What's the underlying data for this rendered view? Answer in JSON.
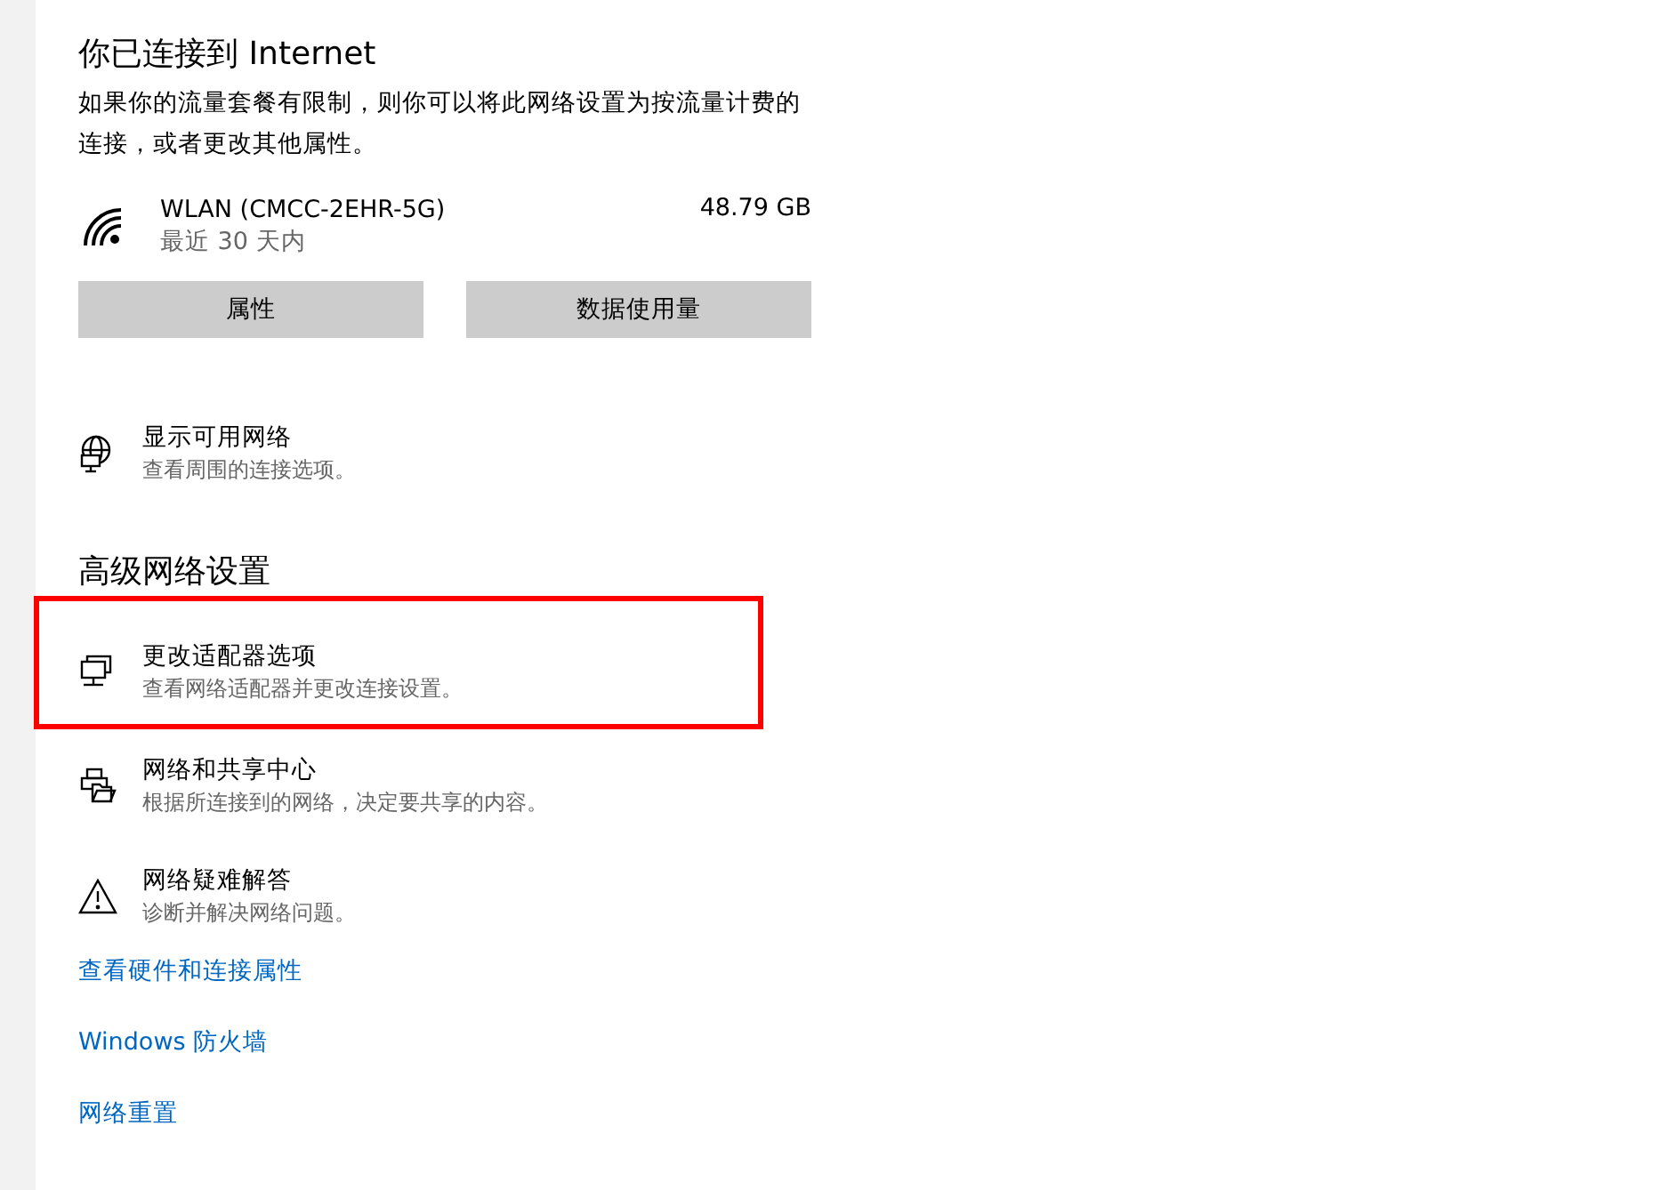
{
  "status": {
    "title": "你已连接到 Internet",
    "description": "如果你的流量套餐有限制，则你可以将此网络设置为按流量计费的连接，或者更改其他属性。"
  },
  "connection": {
    "name": "WLAN (CMCC-2EHR-5G)",
    "period": "最近 30 天内",
    "usage": "48.79 GB"
  },
  "buttons": [
    "属性",
    "数据使用量"
  ],
  "show_networks": {
    "kind": "globe",
    "title": "显示可用网络",
    "subtitle": "查看周围的连接选项。",
    "highlighted": false
  },
  "advanced": {
    "title": "高级网络设置",
    "items": [
      {
        "kind": "adapter",
        "title": "更改适配器选项",
        "subtitle": "查看网络适配器并更改连接设置。",
        "highlighted": true
      },
      {
        "kind": "sharing",
        "title": "网络和共享中心",
        "subtitle": "根据所连接到的网络，决定要共享的内容。",
        "highlighted": false
      },
      {
        "kind": "warning",
        "title": "网络疑难解答",
        "subtitle": "诊断并解决网络问题。",
        "highlighted": false
      }
    ]
  },
  "links": [
    "查看硬件和连接属性",
    "Windows 防火墙",
    "网络重置"
  ]
}
